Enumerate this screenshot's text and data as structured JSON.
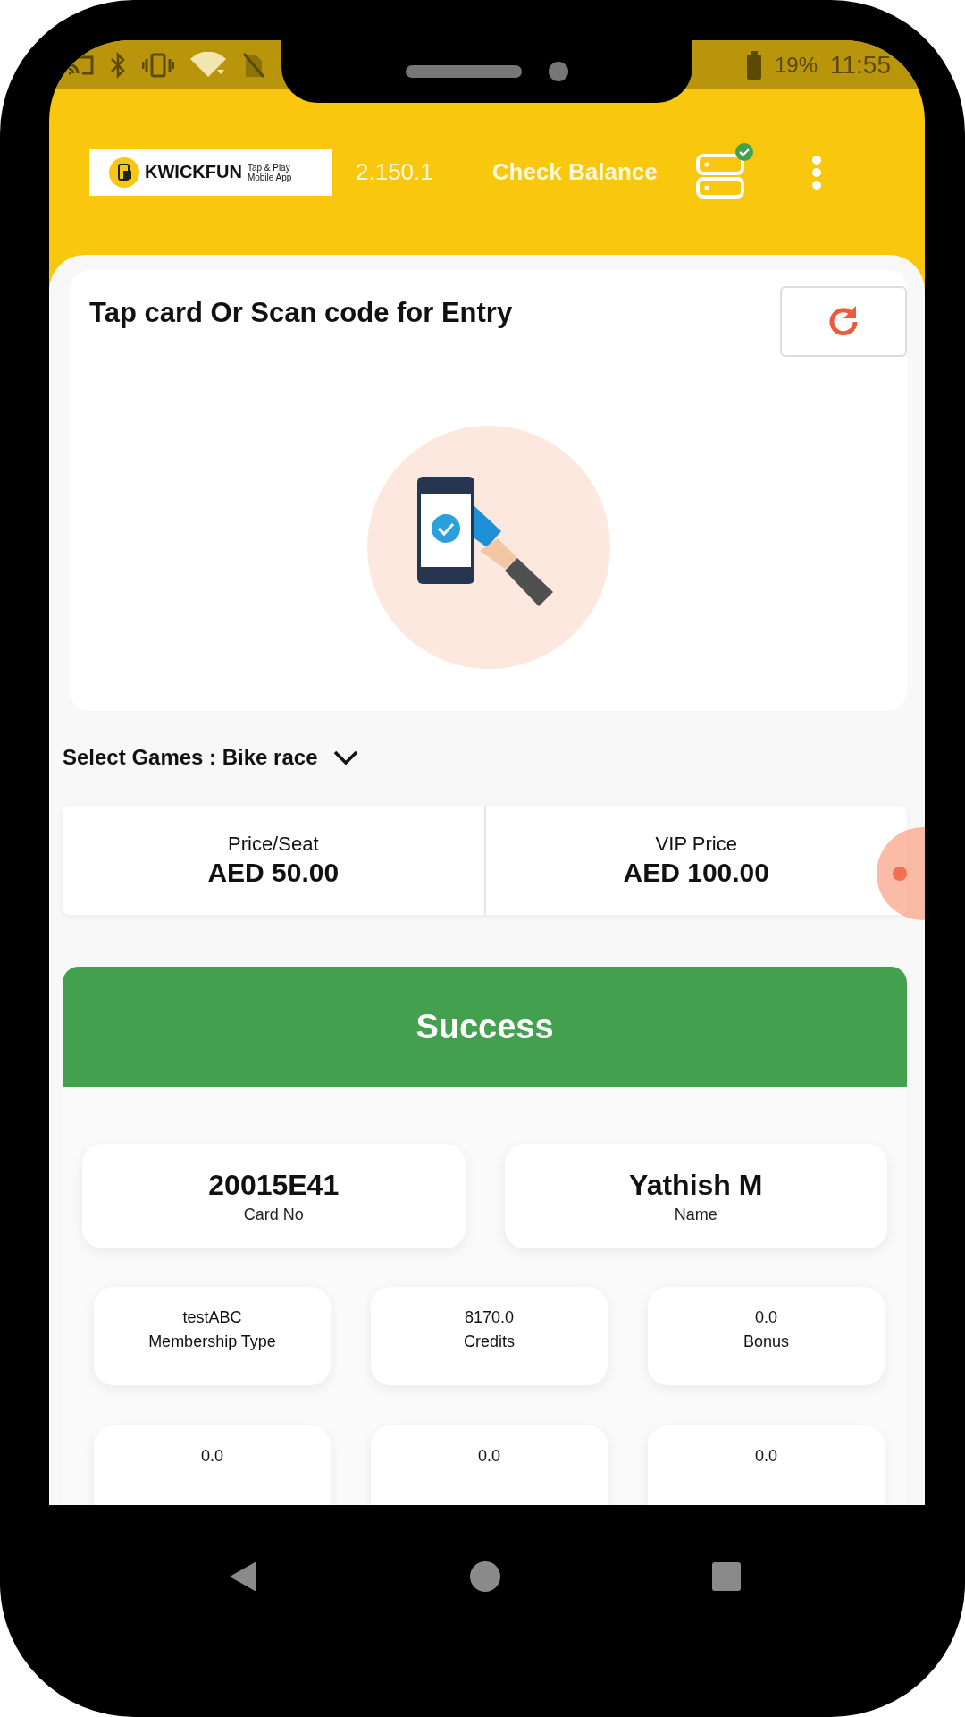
{
  "status_bar": {
    "battery": "19%",
    "time": "11:55"
  },
  "header": {
    "logo": {
      "name": "KWICKFUN",
      "tagline_1": "Tap & Play",
      "tagline_2": "Mobile App"
    },
    "version": "2.150.1",
    "check_balance": "Check Balance",
    "server_connected": true
  },
  "entry": {
    "title": "Tap card Or Scan code for Entry"
  },
  "game_select": {
    "label": "Select Games : Bike race"
  },
  "prices": [
    {
      "label": "Price/Seat",
      "value": "AED 50.00"
    },
    {
      "label": "VIP Price",
      "value": "AED 100.00"
    }
  ],
  "result": {
    "title": "Success",
    "success": true,
    "primary": [
      {
        "value": "20015E41",
        "label": "Card No"
      },
      {
        "value": "Yathish M",
        "label": "Name"
      }
    ],
    "stats": [
      {
        "value": "testABC",
        "label": "Membership Type"
      },
      {
        "value": "8170.0",
        "label": "Credits"
      },
      {
        "value": "0.0",
        "label": "Bonus"
      },
      {
        "value": "0.0"
      },
      {
        "value": "0.0"
      },
      {
        "value": "0.0"
      }
    ]
  }
}
